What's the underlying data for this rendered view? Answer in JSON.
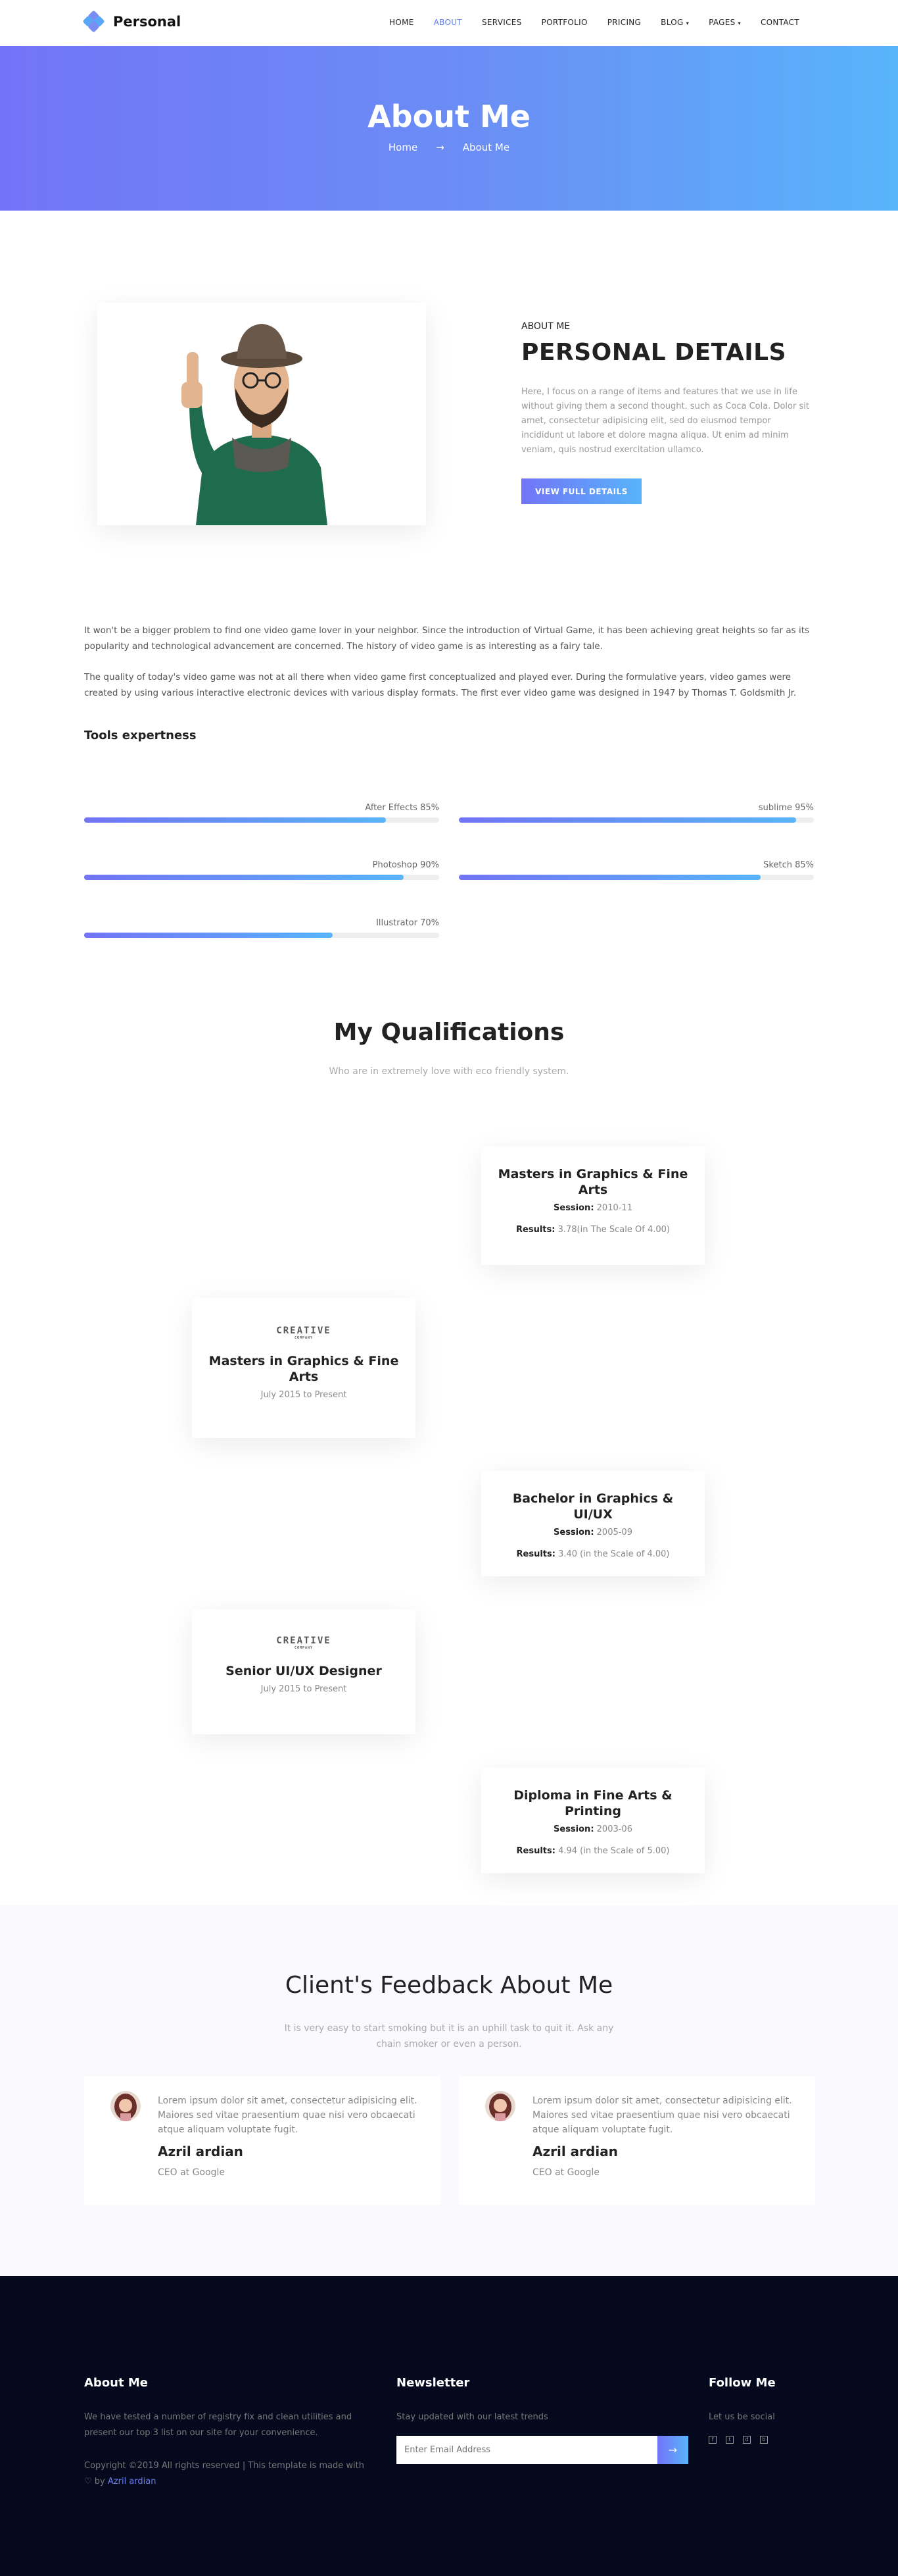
{
  "brand": {
    "name": "Personal",
    "colors": {
      "accent": "#5b7bf2",
      "gradient_start": "#7274f7",
      "gradient_end": "#58b4fb",
      "footer_bg": "#04091e"
    }
  },
  "nav": {
    "items": [
      {
        "label": "HOME"
      },
      {
        "label": "ABOUT",
        "active": true
      },
      {
        "label": "SERVICES"
      },
      {
        "label": "PORTFOLIO"
      },
      {
        "label": "PRICING"
      },
      {
        "label": "BLOG"
      },
      {
        "label": "PAGES"
      },
      {
        "label": "CONTACT"
      }
    ]
  },
  "banner": {
    "title": "About Me",
    "breadcrumb_home": "Home",
    "breadcrumb_arrow": "→",
    "breadcrumb_current": "About Me"
  },
  "about": {
    "eyebrow": "ABOUT ME",
    "title": "PERSONAL DETAILS",
    "text": "Here, I focus on a range of items and features that we use in life without giving them a second thought. such as Coca Cola. Dolor sit amet, consectetur adipisicing elit, sed do eiusmod tempor incididunt ut labore et dolore magna aliqua. Ut enim ad minim veniam, quis nostrud exercitation ullamco.",
    "button": "VIEW FULL DETAILS",
    "para1": "It won't be a bigger problem to find one video game lover in your neighbor. Since the introduction of Virtual Game, it has been achieving great heights so far as its popularity and technological advancement are concerned. The history of video game is as interesting as a fairy tale.",
    "para2": "The quality of today's video game was not at all there when video game first conceptualized and played ever. During the formulative years, video games were created by using various interactive electronic devices with various display formats. The first ever video game was designed in 1947 by Thomas T. Goldsmith Jr."
  },
  "tools": {
    "title": "Tools expertness",
    "skills": [
      {
        "label": "After Effects 85%",
        "percent": 85
      },
      {
        "label": "sublime 95%",
        "percent": 95
      },
      {
        "label": "Photoshop 90%",
        "percent": 90
      },
      {
        "label": "Sketch 85%",
        "percent": 85
      },
      {
        "label": "Illustrator 70%",
        "percent": 70
      }
    ]
  },
  "qualifications": {
    "title": "My Qualifications",
    "subtitle": "Who are in extremely love with eco friendly system.",
    "logo_text": "CREATIVE",
    "logo_sub": "COMPANY",
    "cards": [
      {
        "title": "Masters in Graphics & Fine Arts",
        "session_label": "Session:",
        "session": "2010-11",
        "results_label": "Results:",
        "results": "3.78(in The Scale Of 4.00)"
      },
      {
        "title": "Masters in Graphics & Fine Arts",
        "period": "July 2015 to Present"
      },
      {
        "title": "Bachelor in Graphics & UI/UX",
        "session_label": "Session:",
        "session": "2005-09",
        "results_label": "Results:",
        "results": "3.40 (in the Scale of 4.00)"
      },
      {
        "title": "Senior UI/UX Designer",
        "period": "July 2015 to Present"
      },
      {
        "title": "Diploma in Fine Arts & Printing",
        "session_label": "Session:",
        "session": "2003-06",
        "results_label": "Results:",
        "results": "4.94 (in the Scale of 5.00)"
      }
    ]
  },
  "feedback": {
    "title": "Client's Feedback About Me",
    "subtitle": "It is very easy to start smoking but it is an uphill task to quit it. Ask any chain smoker or even a person.",
    "items": [
      {
        "text": "Lorem ipsum dolor sit amet, consectetur adipisicing elit. Maiores sed vitae praesentium quae nisi vero obcaecati atque aliquam voluptate fugit.",
        "name": "Azril ardian",
        "role": "CEO at Google"
      },
      {
        "text": "Lorem ipsum dolor sit amet, consectetur adipisicing elit. Maiores sed vitae praesentium quae nisi vero obcaecati atque aliquam voluptate fugit.",
        "name": "Azril ardian",
        "role": "CEO at Google"
      }
    ]
  },
  "footer": {
    "about_title": "About Me",
    "about_text": "We have tested a number of registry fix and clean utilities and present our top 3 list on our site for your convenience.",
    "copyright": "Copyright ©2019 All rights reserved | This template is made with",
    "by": "by",
    "author": "Azril ardian",
    "newsletter_title": "Newsletter",
    "newsletter_text": "Stay updated with our latest trends",
    "email_placeholder": "Enter Email Address",
    "follow_title": "Follow Me",
    "follow_text": "Let us be social"
  }
}
